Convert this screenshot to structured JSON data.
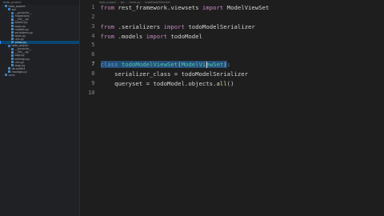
{
  "sidebar": {
    "header": "todo_project",
    "items": [
      {
        "label": "todo_project",
        "kind": "folder",
        "depth": 0,
        "expanded": true,
        "selected": false
      },
      {
        "label": "api",
        "kind": "folder",
        "depth": 1,
        "expanded": true,
        "selected": false
      },
      {
        "label": "__pycache__",
        "kind": "folder",
        "depth": 2,
        "expanded": false,
        "selected": false
      },
      {
        "label": "migrations",
        "kind": "folder",
        "depth": 2,
        "expanded": false,
        "selected": false
      },
      {
        "label": "__init__.py",
        "kind": "init",
        "depth": 2,
        "selected": false
      },
      {
        "label": "admin.py",
        "kind": "py",
        "depth": 2,
        "selected": false
      },
      {
        "label": "apps.py",
        "kind": "py",
        "depth": 2,
        "selected": false
      },
      {
        "label": "models.py",
        "kind": "py",
        "depth": 2,
        "selected": false
      },
      {
        "label": "serializers.py",
        "kind": "py",
        "depth": 2,
        "selected": false
      },
      {
        "label": "tests.py",
        "kind": "py",
        "depth": 2,
        "selected": false
      },
      {
        "label": "urls.py",
        "kind": "py",
        "depth": 2,
        "selected": false
      },
      {
        "label": "views.py",
        "kind": "py",
        "depth": 2,
        "selected": true
      },
      {
        "label": "todo_project",
        "kind": "folder",
        "depth": 1,
        "expanded": true,
        "selected": false
      },
      {
        "label": "__pycache__",
        "kind": "folder",
        "depth": 2,
        "expanded": false,
        "selected": false
      },
      {
        "label": "__init__.py",
        "kind": "init",
        "depth": 2,
        "selected": false
      },
      {
        "label": "asgi.py",
        "kind": "py",
        "depth": 2,
        "selected": false
      },
      {
        "label": "settings.py",
        "kind": "py",
        "depth": 2,
        "selected": false
      },
      {
        "label": "urls.py",
        "kind": "py",
        "depth": 2,
        "selected": false
      },
      {
        "label": "wsgi.py",
        "kind": "py",
        "depth": 2,
        "selected": false
      },
      {
        "label": "db.sqlite3",
        "kind": "py",
        "depth": 1,
        "selected": false
      },
      {
        "label": "manage.py",
        "kind": "py",
        "depth": 1,
        "selected": false
      },
      {
        "label": "venv",
        "kind": "folder",
        "depth": 0,
        "expanded": false,
        "selected": false
      }
    ]
  },
  "breadcrumb": [
    "todo_project",
    "api",
    "views.py",
    "todoModelViewSet"
  ],
  "editor": {
    "active_line": 7,
    "lines": [
      {
        "n": "1",
        "tokens": [
          {
            "t": "from ",
            "c": "kw"
          },
          {
            "t": "rest_framework.viewsets "
          },
          {
            "t": "import ",
            "c": "kw"
          },
          {
            "t": "ModelViewSet"
          }
        ]
      },
      {
        "n": "2",
        "tokens": []
      },
      {
        "n": "3",
        "tokens": [
          {
            "t": "from ",
            "c": "kw"
          },
          {
            "t": ".serializers "
          },
          {
            "t": "import ",
            "c": "kw"
          },
          {
            "t": "todoModelSerializer"
          }
        ]
      },
      {
        "n": "4",
        "tokens": [
          {
            "t": "from ",
            "c": "kw"
          },
          {
            "t": ".models "
          },
          {
            "t": "import ",
            "c": "kw"
          },
          {
            "t": "todoModel"
          }
        ]
      },
      {
        "n": "5",
        "tokens": []
      },
      {
        "n": "6",
        "tokens": []
      },
      {
        "n": "7",
        "tokens": [
          {
            "t": "class ",
            "c": "kwb",
            "sel": true
          },
          {
            "t": "todoModelViewSet",
            "c": "cls",
            "sel": true
          },
          {
            "t": "(",
            "sel": true
          },
          {
            "t": "ModelViewSet",
            "c": "cls",
            "sel": true
          },
          {
            "t": ")",
            "sel": true
          },
          {
            "t": ":"
          }
        ]
      },
      {
        "n": "8",
        "tokens": [
          {
            "t": "    serializer_class = todoModelSerializer"
          }
        ]
      },
      {
        "n": "9",
        "tokens": [
          {
            "t": "    queryset = todoModel.objects."
          },
          {
            "t": "all",
            "c": "fn"
          },
          {
            "t": "()"
          }
        ]
      },
      {
        "n": "10",
        "tokens": []
      }
    ]
  }
}
